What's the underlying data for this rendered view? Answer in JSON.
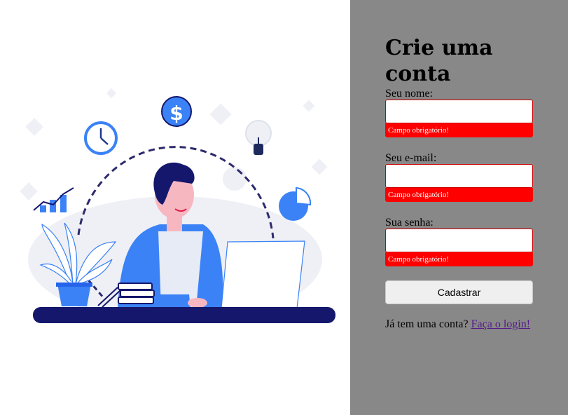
{
  "form": {
    "title": "Crie uma conta",
    "fields": [
      {
        "label": "Seu nome:",
        "value": "",
        "error": "Campo obrigatório!"
      },
      {
        "label": "Seu e-mail:",
        "value": "",
        "error": "Campo obrigatório!"
      },
      {
        "label": "Sua senha:",
        "value": "",
        "error": "Campo obrigatório!"
      }
    ],
    "submit_label": "Cadastrar",
    "login_prompt": "Já tem uma conta?",
    "login_link": "Faça o login!"
  },
  "illustration": {
    "description_icons": [
      "clock-icon",
      "dollar-coin-icon",
      "lightbulb-icon",
      "pie-chart-icon",
      "bar-chart-icon",
      "plant-icon",
      "laptop-icon",
      "books-icon"
    ],
    "colors": {
      "primary_blue": "#3b82f6",
      "dark_navy": "#14176b",
      "skin": "#f7b7c0",
      "hair": "#101a6b",
      "form_panel": "#888888",
      "error_red": "#ff0000"
    }
  }
}
